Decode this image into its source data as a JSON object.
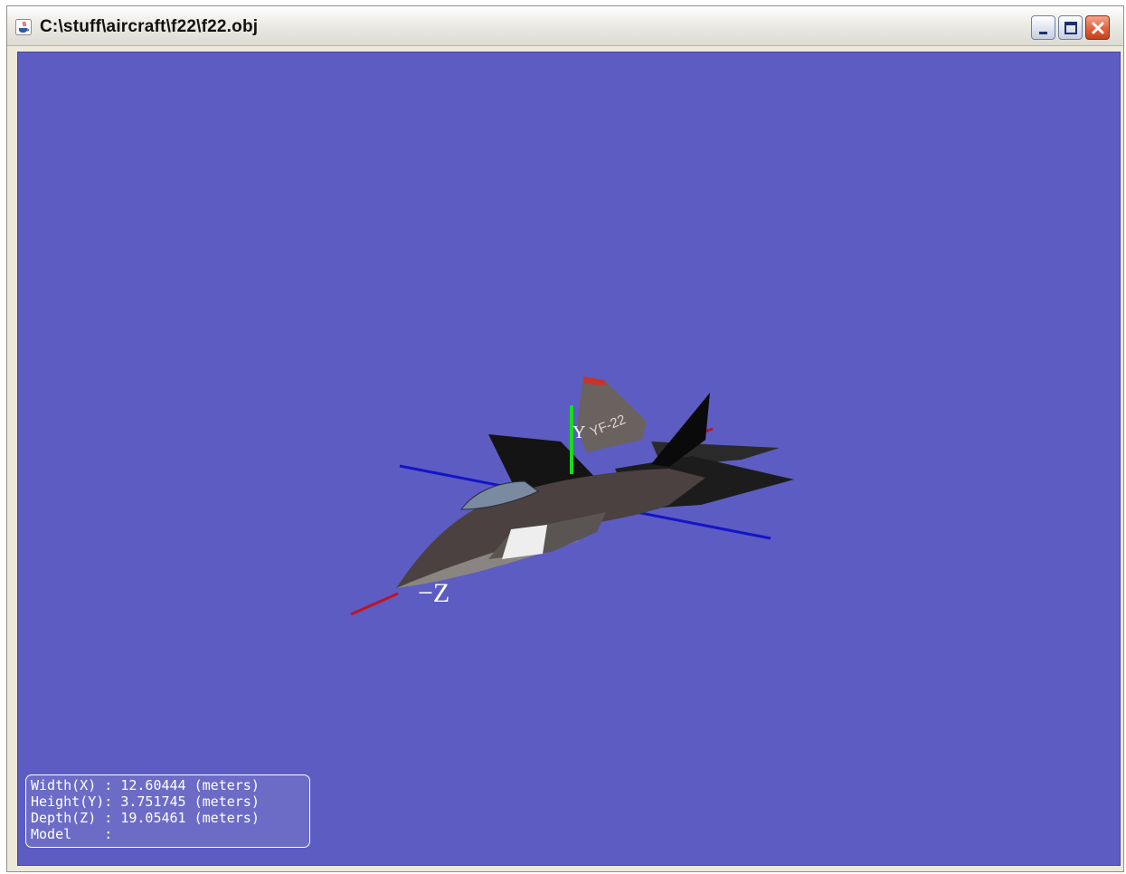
{
  "window": {
    "title": "C:\\stuff\\aircraft\\f22\\f22.obj",
    "icon": "java-icon",
    "controls": [
      {
        "name": "minimize-button",
        "icon": "minimize-icon"
      },
      {
        "name": "maximize-button",
        "icon": "maximize-icon"
      },
      {
        "name": "close-button",
        "icon": "close-icon"
      }
    ]
  },
  "viewport": {
    "background": "#5c5cc2",
    "axes": {
      "x_color": "#c0141e",
      "y_color": "#14e014",
      "z_color": "#1414c8",
      "labels": {
        "neg_z": "−Z",
        "y": "Y"
      }
    },
    "model": {
      "tail_marking": "YF-22"
    }
  },
  "info": {
    "rows": [
      {
        "label": "Width(X) :",
        "value": "12.60444",
        "unit": "(meters)"
      },
      {
        "label": "Height(Y):",
        "value": "3.751745",
        "unit": "(meters)"
      },
      {
        "label": "Depth(Z) :",
        "value": "19.05461",
        "unit": "(meters)"
      },
      {
        "label": "Model    :",
        "value": "",
        "unit": ""
      }
    ]
  }
}
